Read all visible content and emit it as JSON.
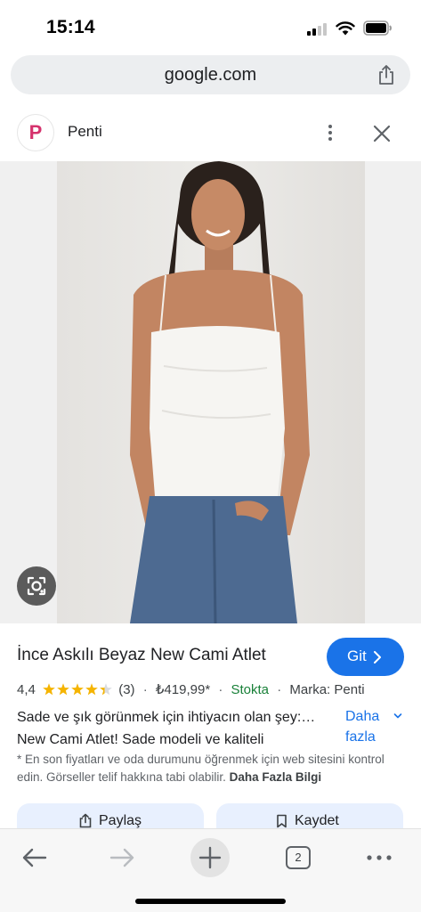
{
  "status_bar": {
    "time": "15:14"
  },
  "browser": {
    "url": "google.com",
    "open_tabs": "2"
  },
  "site": {
    "logo_letter": "P",
    "name": "Penti"
  },
  "product": {
    "title": "İnce Askılı Beyaz New Cami Atlet",
    "go_button": "Git",
    "rating": "4,4",
    "rating_value": 4.4,
    "rating_max": 5,
    "review_count": "(3)",
    "price": "₺419,99*",
    "stock": "Stokta",
    "brand": "Marka: Penti",
    "description_line1": "Sade ve şık görünmek için ihtiyacın olan şey:…",
    "description_line2": "New Cami Atlet! Sade modeli ve kaliteli",
    "more_label_line1": "Daha",
    "more_label_line2": "fazla",
    "disclaimer": "* En son fiyatları ve oda durumunu öğrenmek için web sitesini kontrol edin. Görseller telif hakkına tabi olabilir.",
    "disclaimer_link": "Daha Fazla Bilgi",
    "share_button": "Paylaş",
    "save_button": "Kaydet"
  },
  "colors": {
    "accent_blue": "#1a73e8",
    "stock_green": "#188038",
    "star_gold": "#f5b400",
    "brand_pink": "#d5336d"
  },
  "icons": [
    "signal-icon",
    "wifi-icon",
    "battery-icon",
    "share-icon",
    "more-vert-icon",
    "close-icon",
    "lens-icon",
    "chevron-right-icon",
    "chevron-down-icon",
    "bookmark-icon",
    "back-arrow-icon",
    "forward-arrow-icon",
    "plus-icon",
    "tabs-icon",
    "more-horiz-icon"
  ]
}
